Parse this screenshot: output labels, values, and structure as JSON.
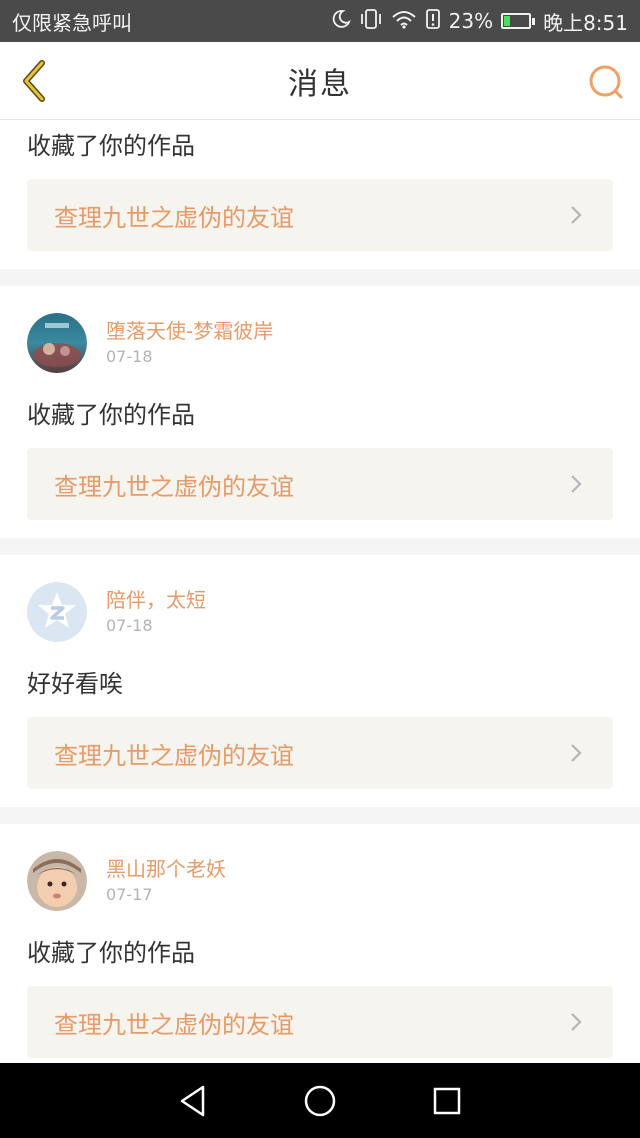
{
  "status_bar": {
    "carrier": "仅限紧急呼叫",
    "battery": "23%",
    "battery_level": 0.23,
    "time": "晚上8:51",
    "icons": [
      "moon-icon",
      "vibrate-icon",
      "wifi-icon",
      "alert-icon",
      "battery-icon"
    ]
  },
  "header": {
    "title": "消息",
    "back_icon": "back-chevron-icon",
    "search_icon": "search-icon"
  },
  "feed": {
    "items": [
      {
        "action": "收藏了你的作品",
        "work_title": "查理九世之虚伪的友谊"
      },
      {
        "username": "堕落天使-梦霜彼岸",
        "date": "07-18",
        "avatar": "avatar-fantasy",
        "action": "收藏了你的作品",
        "work_title": "查理九世之虚伪的友谊"
      },
      {
        "username": "陪伴，太短",
        "date": "07-18",
        "avatar": "avatar-qzone-default",
        "action": "好好看唉",
        "work_title": "查理九世之虚伪的友谊"
      },
      {
        "username": "黑山那个老妖",
        "date": "07-17",
        "avatar": "avatar-baby",
        "action": "收藏了你的作品",
        "work_title": "查理九世之虚伪的友谊"
      }
    ]
  },
  "colors": {
    "accent": "#e89a67",
    "status_bar_bg": "#4a4a4a",
    "card_bg": "#f5f4ef",
    "nav_bg": "#000000"
  },
  "nav_bar": {
    "icons": [
      "back-triangle-icon",
      "home-circle-icon",
      "recents-square-icon"
    ]
  }
}
